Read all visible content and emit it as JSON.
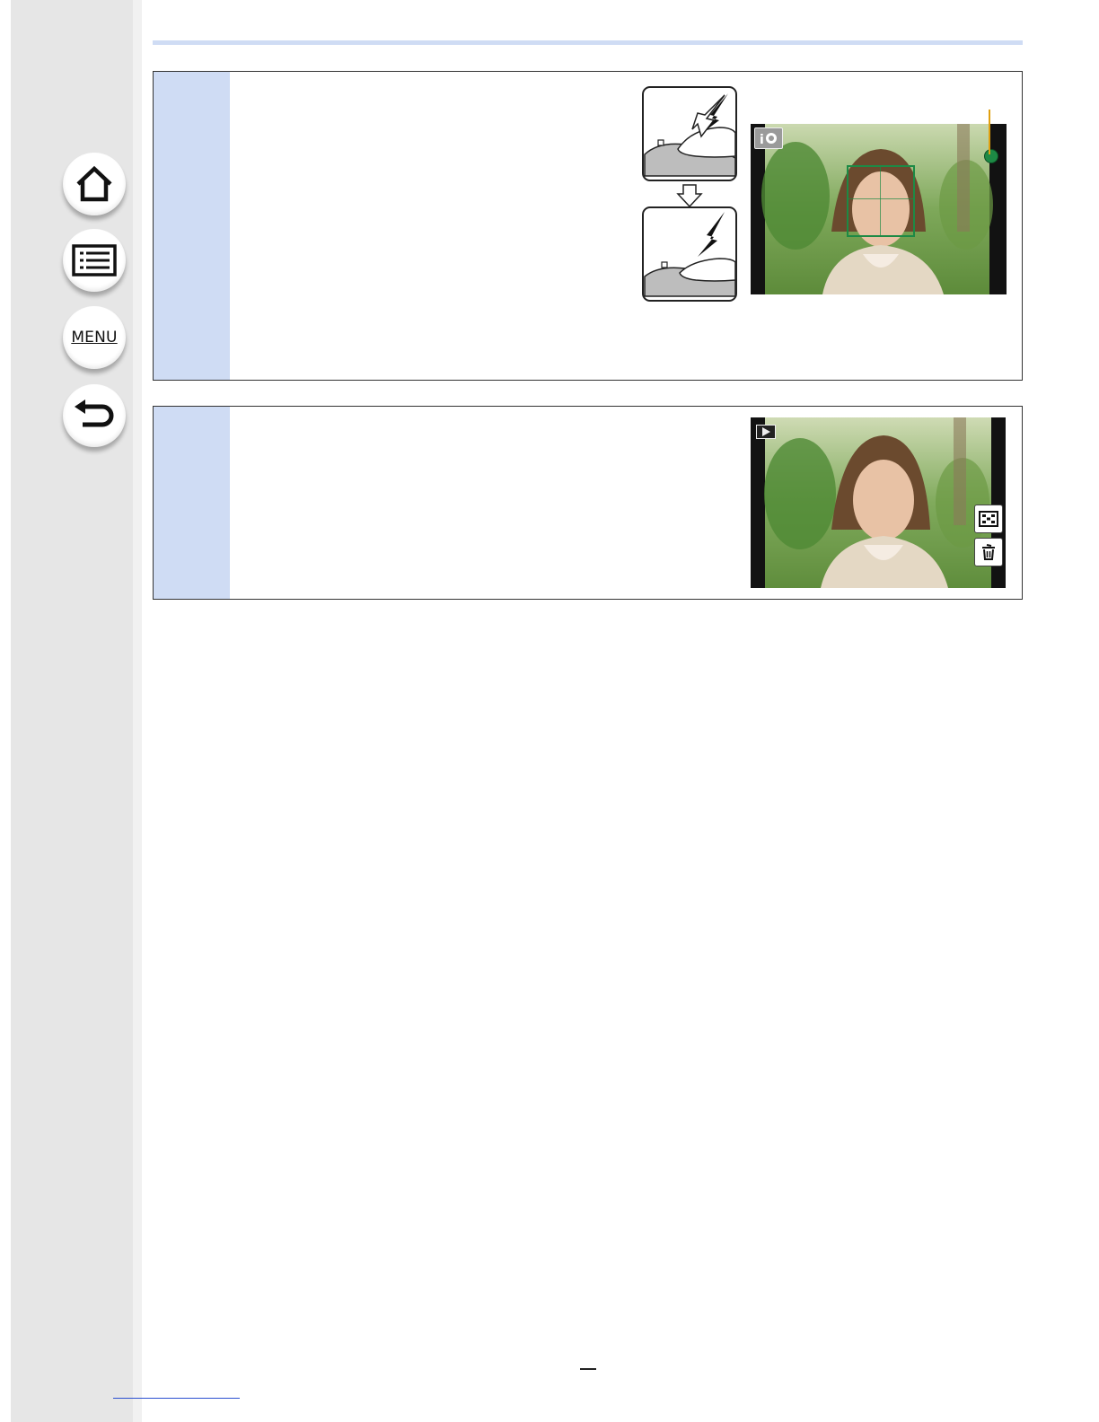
{
  "nav": {
    "home": {
      "icon": "home-icon"
    },
    "contents": {
      "icon": "list-icon"
    },
    "menu": {
      "label": "MENU"
    },
    "back": {
      "icon": "return-icon"
    }
  },
  "colors": {
    "tab_blue": "#cfdcf4",
    "focus_green": "#1d8a45",
    "indicator_orange": "#e0a010"
  }
}
